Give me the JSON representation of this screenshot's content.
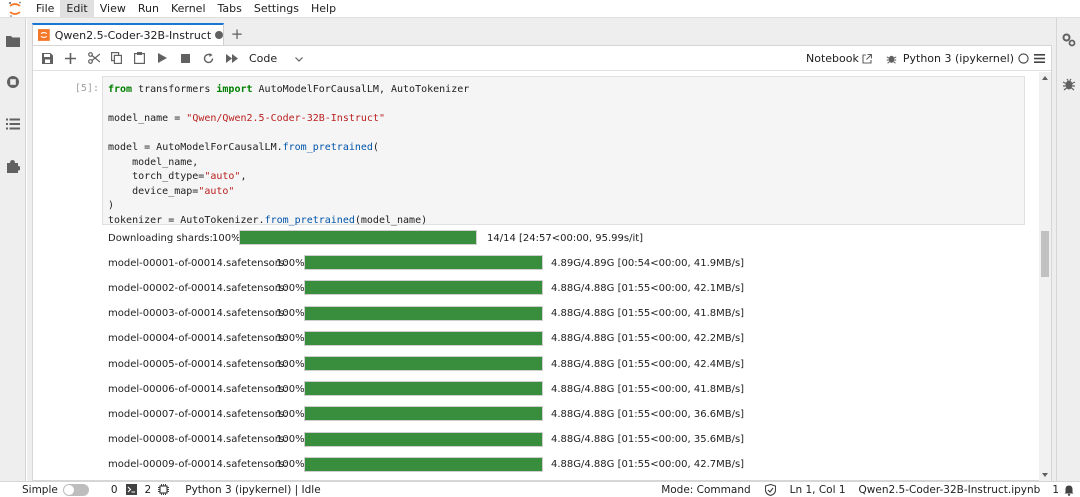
{
  "menu": [
    "File",
    "Edit",
    "View",
    "Run",
    "Kernel",
    "Tabs",
    "Settings",
    "Help"
  ],
  "tab": {
    "label": "Qwen2.5-Coder-32B-Instruct"
  },
  "toolbar": {
    "cell_type": "Code",
    "notebook_label": "Notebook",
    "kernel_label": "Python 3 (ipykernel)"
  },
  "cell": {
    "prompt": "[5]:",
    "code_lines": [
      [
        {
          "t": "from",
          "c": "kw"
        },
        {
          "t": " transformers "
        },
        {
          "t": "import",
          "c": "kw"
        },
        {
          "t": " AutoModelForCausalLM, AutoTokenizer"
        }
      ],
      [],
      [
        {
          "t": "model_name "
        },
        {
          "t": "=",
          "c": "op"
        },
        {
          "t": " "
        },
        {
          "t": "\"Qwen/Qwen2.5-Coder-32B-Instruct\"",
          "c": "st"
        }
      ],
      [],
      [
        {
          "t": "model "
        },
        {
          "t": "="
        },
        {
          "t": " AutoModelForCausalLM."
        },
        {
          "t": "from_pretrained",
          "c": "fn"
        },
        {
          "t": "("
        }
      ],
      [
        {
          "t": "    model_name,"
        }
      ],
      [
        {
          "t": "    torch_dtype="
        },
        {
          "t": "\"auto\"",
          "c": "st"
        },
        {
          "t": ","
        }
      ],
      [
        {
          "t": "    device_map="
        },
        {
          "t": "\"auto\"",
          "c": "st"
        }
      ],
      [
        {
          "t": ")"
        }
      ],
      [
        {
          "t": "tokenizer "
        },
        {
          "t": "="
        },
        {
          "t": " AutoTokenizer."
        },
        {
          "t": "from_pretrained",
          "c": "fn"
        },
        {
          "t": "(model_name)"
        }
      ]
    ]
  },
  "downloads": [
    {
      "label": "Downloading shards:",
      "pct": "100%",
      "progress": 1.0,
      "stats": "14/14 [24:57<00:00, 95.99s/it]"
    },
    {
      "label": "model-00001-of-00014.safetensors:",
      "pct": "100%",
      "progress": 1.0,
      "stats": "4.89G/4.89G [00:54<00:00, 41.9MB/s]"
    },
    {
      "label": "model-00002-of-00014.safetensors:",
      "pct": "100%",
      "progress": 1.0,
      "stats": "4.88G/4.88G [01:55<00:00, 42.1MB/s]"
    },
    {
      "label": "model-00003-of-00014.safetensors:",
      "pct": "100%",
      "progress": 1.0,
      "stats": "4.88G/4.88G [01:55<00:00, 41.8MB/s]"
    },
    {
      "label": "model-00004-of-00014.safetensors:",
      "pct": "100%",
      "progress": 1.0,
      "stats": "4.88G/4.88G [01:55<00:00, 42.2MB/s]"
    },
    {
      "label": "model-00005-of-00014.safetensors:",
      "pct": "100%",
      "progress": 1.0,
      "stats": "4.88G/4.88G [01:55<00:00, 42.4MB/s]"
    },
    {
      "label": "model-00006-of-00014.safetensors:",
      "pct": "100%",
      "progress": 1.0,
      "stats": "4.88G/4.88G [01:55<00:00, 41.8MB/s]"
    },
    {
      "label": "model-00007-of-00014.safetensors:",
      "pct": "100%",
      "progress": 1.0,
      "stats": "4.88G/4.88G [01:55<00:00, 36.6MB/s]"
    },
    {
      "label": "model-00008-of-00014.safetensors:",
      "pct": "100%",
      "progress": 1.0,
      "stats": "4.88G/4.88G [01:55<00:00, 35.6MB/s]"
    },
    {
      "label": "model-00009-of-00014.safetensors:",
      "pct": "100%",
      "progress": 1.0,
      "stats": "4.88G/4.88G [01:55<00:00, 42.7MB/s]"
    }
  ],
  "statusbar": {
    "mode_simple": "Simple",
    "terminals": "0",
    "kernels": "2",
    "kernel_status": "Python 3 (ipykernel) | Idle",
    "mode": "Mode: Command",
    "position": "Ln 1, Col 1",
    "filename": "Qwen2.5-Coder-32B-Instruct.ipynb",
    "notifications": "1"
  },
  "colors": {
    "progress_fill": "#388e3c",
    "accent": "#1976d2",
    "logo": "#f37726"
  },
  "icons": {
    "logo": "jupyter-logo-icon",
    "left_sidebar": [
      "folder-icon",
      "running-icon",
      "toc-icon",
      "extension-icon"
    ],
    "right_sidebar": [
      "property-inspector-icon",
      "debugger-icon"
    ],
    "toolbar": [
      "save-icon",
      "add-cell-icon",
      "cut-icon",
      "copy-icon",
      "paste-icon",
      "run-icon",
      "stop-icon",
      "restart-icon",
      "fast-forward-icon"
    ]
  }
}
